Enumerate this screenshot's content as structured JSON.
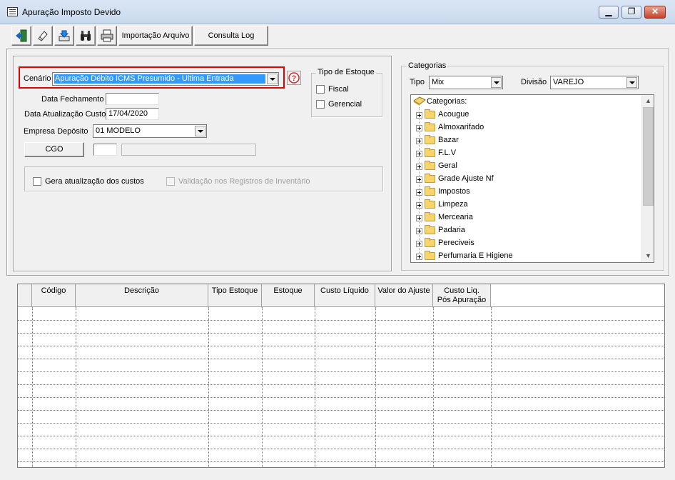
{
  "window": {
    "title": "Apuração Imposto Devido",
    "minimize": "▁",
    "maximize": "❐",
    "close": "✕"
  },
  "toolbar": {
    "icons": [
      "exit-door-icon",
      "eraser-icon",
      "import-tray-icon",
      "binoculars-icon",
      "printer-icon"
    ],
    "importacao_label": "Importação Arquivo",
    "consulta_label": "Consulta Log"
  },
  "cenario": {
    "label": "Cenário",
    "value": "Apuração Débito ICMS Presumido - Ultima Entrada",
    "help_icon": "help-icon",
    "highlight_color": "#e00000",
    "selected_bg": "#3399ff"
  },
  "tipo_estoque": {
    "title": "Tipo de Estoque",
    "fiscal": "Fiscal",
    "gerencial": "Gerencial"
  },
  "data_fechamento": {
    "label": "Data Fechamento",
    "value": ""
  },
  "data_atualizacao": {
    "label": "Data Atualização Custo",
    "value": "17/04/2020"
  },
  "empresa": {
    "label": "Empresa Depósito",
    "value": "01 MODELO"
  },
  "cgo": {
    "button_label": "CGO",
    "code_value": "",
    "desc_value": ""
  },
  "options": {
    "gera_atualizacao": "Gera atualização dos custos",
    "validacao": "Validação nos Registros de Inventário"
  },
  "categorias": {
    "title": "Categorias",
    "tipo_label": "Tipo",
    "tipo_value": "Mix",
    "divisao_label": "Divisão",
    "divisao_value": "VAREJO",
    "root_label": "Categorias:",
    "items": [
      "Acougue",
      "Almoxarifado",
      "Bazar",
      "F.L.V",
      "Geral",
      "Grade Ajuste Nf",
      "Impostos",
      "Limpeza",
      "Mercearia",
      "Padaria",
      "Pereciveis",
      "Perfumaria E Higiene"
    ]
  },
  "grid": {
    "columns": [
      "Código",
      "Descrição",
      "Tipo Estoque",
      "Estoque",
      "Custo Líquido",
      "Valor do Ajuste",
      "Custo Liq.\nPós Apuração"
    ],
    "rows": []
  }
}
